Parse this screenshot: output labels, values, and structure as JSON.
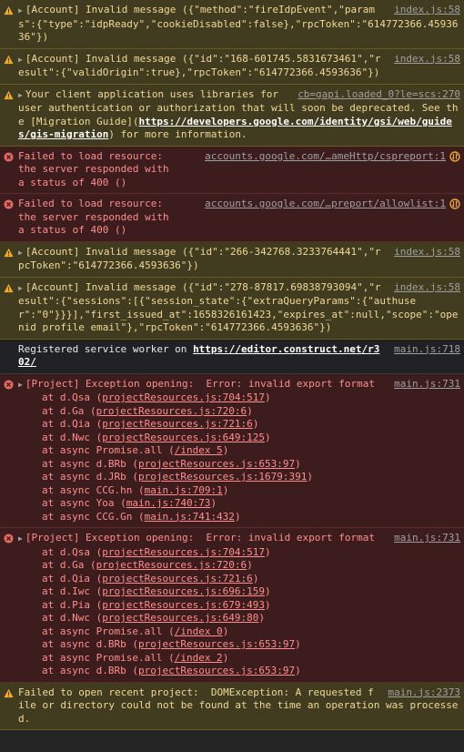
{
  "colors": {
    "warn_bg": "#413b1f",
    "error_bg": "#3c1c1c",
    "info_bg": "#202124"
  },
  "entries": [
    {
      "type": "warn",
      "source": "index.js:58",
      "text": "[Account] Invalid message ({\"method\":\"fireIdpEvent\",\"params\":{\"type\":\"idpReady\",\"cookieDisabled\":false},\"rpcToken\":\"614772366.4593636\"})"
    },
    {
      "type": "warn",
      "source": "index.js:58",
      "text": "[Account] Invalid message ({\"id\":\"168-601745.5831673461\",\"result\":{\"validOrigin\":true},\"rpcToken\":\"614772366.4593636\"})"
    },
    {
      "type": "warn",
      "source": "cb=gapi.loaded_0?le=scs:270",
      "text_a": "Your client application uses libraries for user authentication or authorization that will soon be deprecated. See the [Migration Guide](",
      "link": "https://developers.google.com/identity/gsi/web/guides/gis-migration",
      "text_b": ") for more information."
    },
    {
      "type": "error",
      "text": "Failed to load resource: the server responded with a status of 400 ()",
      "source": "accounts.google.com/…ameHttp/cspreport:1"
    },
    {
      "type": "error",
      "text": "Failed to load resource: the server responded with a status of 400 ()",
      "source": "accounts.google.com/…preport/allowlist:1"
    },
    {
      "type": "warn",
      "source": "index.js:58",
      "text": "[Account] Invalid message ({\"id\":\"266-342768.3233764441\",\"rpcToken\":\"614772366.4593636\"})"
    },
    {
      "type": "warn",
      "source": "index.js:58",
      "text": "[Account] Invalid message ({\"id\":\"278-87817.69838793094\",\"result\":{\"sessions\":[{\"session_state\":{\"extraQueryParams\":{\"authuser\":\"0\"}}}],\"first_issued_at\":1658326161423,\"expires_at\":null,\"scope\":\"openid profile email\"},\"rpcToken\":\"614772366.4593636\"})"
    },
    {
      "type": "info",
      "source": "main.js:718",
      "text": "Registered service worker on ",
      "link": "https://editor.construct.net/r302/"
    },
    {
      "type": "error",
      "source": "main.js:731",
      "text": "[Project] Exception opening:  Error: invalid export format",
      "stack": [
        {
          "pre": "at d.Qsa (",
          "loc": "projectResources.js:704:517"
        },
        {
          "pre": "at d.Ga (",
          "loc": "projectResources.js:720:6"
        },
        {
          "pre": "at d.Qia (",
          "loc": "projectResources.js:721:6"
        },
        {
          "pre": "at d.Nwc (",
          "loc": "projectResources.js:649:125"
        },
        {
          "pre": "at async Promise.all (",
          "loc": "/index 5"
        },
        {
          "pre": "at async d.BRb (",
          "loc": "projectResources.js:653:97"
        },
        {
          "pre": "at async d.JRb (",
          "loc": "projectResources.js:1679:391"
        },
        {
          "pre": "at async CCG.hn (",
          "loc": "main.js:709:1"
        },
        {
          "pre": "at async Yoa (",
          "loc": "main.js:740:73"
        },
        {
          "pre": "at async CCG.Gn (",
          "loc": "main.js:741:432"
        }
      ]
    },
    {
      "type": "error",
      "source": "main.js:731",
      "text": "[Project] Exception opening:  Error: invalid export format",
      "stack": [
        {
          "pre": "at d.Qsa (",
          "loc": "projectResources.js:704:517"
        },
        {
          "pre": "at d.Ga (",
          "loc": "projectResources.js:720:6"
        },
        {
          "pre": "at d.Qia (",
          "loc": "projectResources.js:721:6"
        },
        {
          "pre": "at d.Iwc (",
          "loc": "projectResources.js:696:159"
        },
        {
          "pre": "at d.Pia (",
          "loc": "projectResources.js:679:493"
        },
        {
          "pre": "at d.Nwc (",
          "loc": "projectResources.js:649:80"
        },
        {
          "pre": "at async Promise.all (",
          "loc": "/index 0"
        },
        {
          "pre": "at async d.BRb (",
          "loc": "projectResources.js:653:97"
        },
        {
          "pre": "at async Promise.all (",
          "loc": "/index 2"
        },
        {
          "pre": "at async d.BRb (",
          "loc": "projectResources.js:653:97"
        }
      ]
    },
    {
      "type": "warn",
      "source": "main.js:2373",
      "text": "Failed to open recent project:  DOMException: A requested file or directory could not be found at the time an operation was processed."
    }
  ]
}
